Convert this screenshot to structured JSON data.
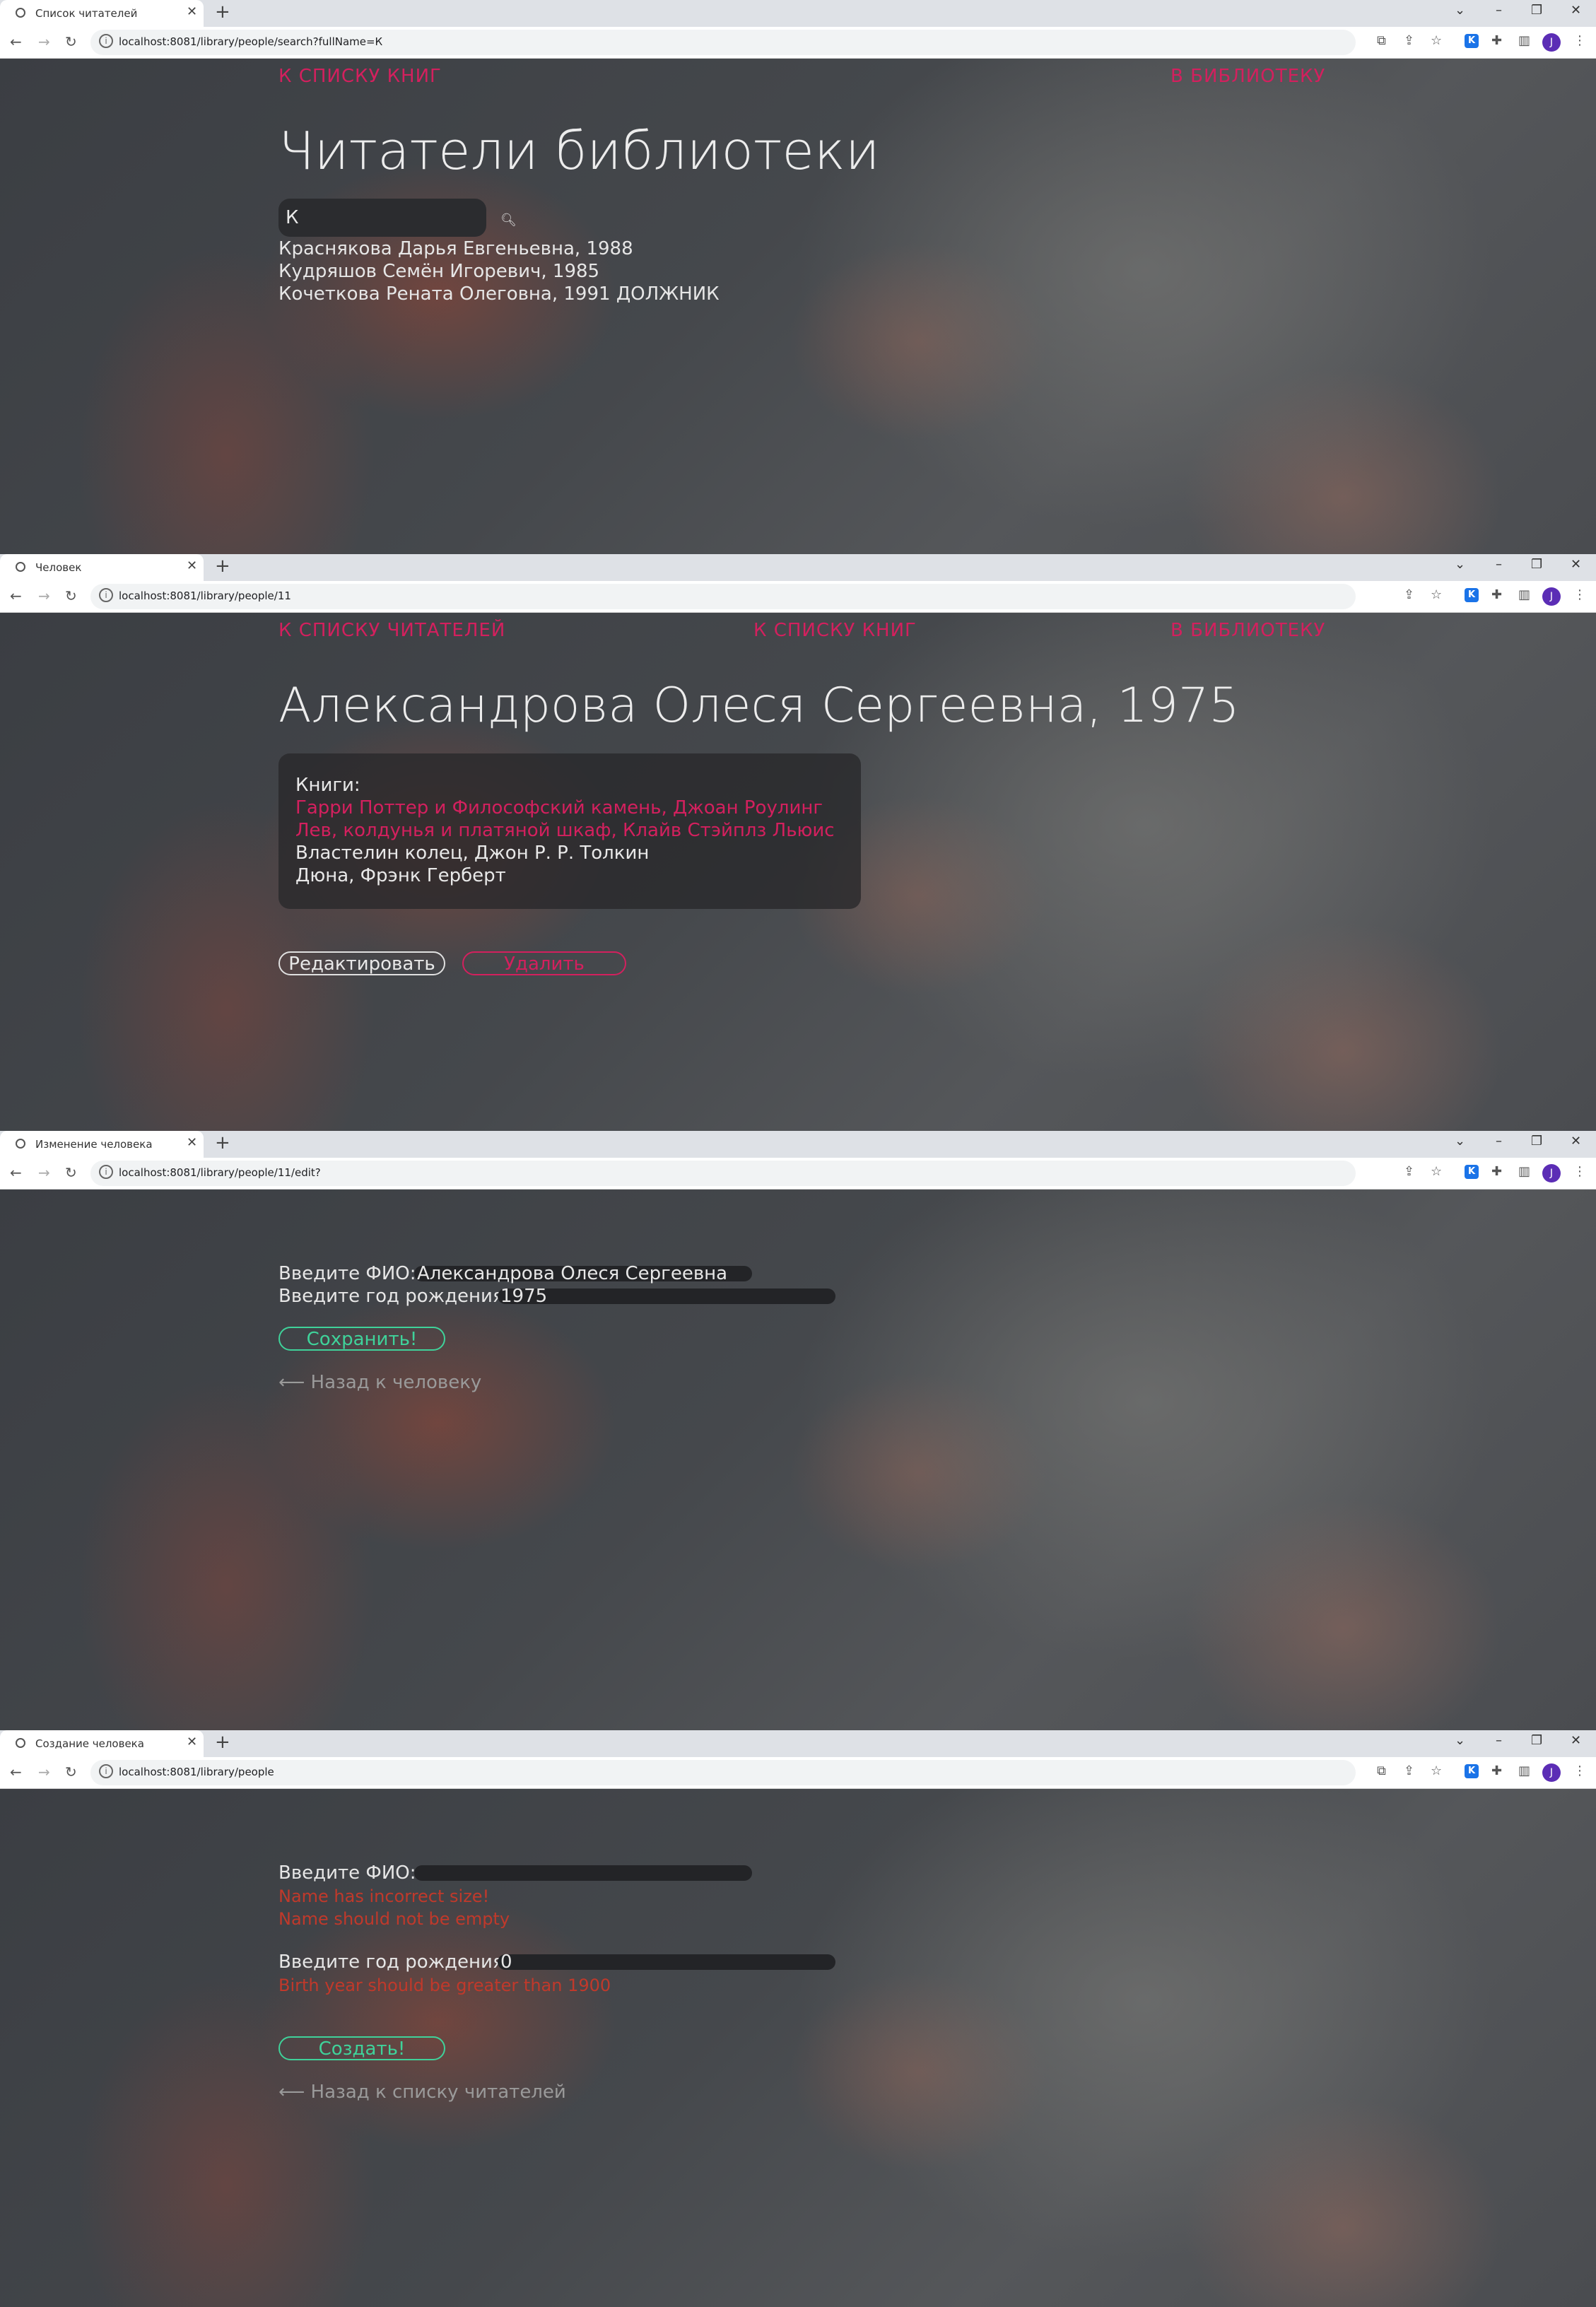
{
  "screens": [
    {
      "tab_title": "Список читателей",
      "url": "localhost:8081/library/people/search?fullName=К",
      "nav_left": "К СПИСКУ КНИГ",
      "nav_right": "В БИБЛИОТЕКУ",
      "title": "Читатели библиотеки",
      "search_value": "К",
      "results": [
        "Краснякова Дарья Евгеньевна, 1988",
        "Кудряшов Семён Игоревич, 1985",
        "Кочеткова Рената Олеговна, 1991 ДОЛЖНИК"
      ]
    },
    {
      "tab_title": "Человек",
      "url": "localhost:8081/library/people/11",
      "nav_left": "К СПИСКУ ЧИТАТЕЛЕЙ",
      "nav_center": "К СПИСКУ КНИГ",
      "nav_right": "В БИБЛИОТЕКУ",
      "title": "Александрова Олеся Сергеевна, 1975",
      "books_label": "Книги:",
      "books": [
        {
          "text": "Гарри Поттер и Философский камень, Джоан Роулинг",
          "overdue": true
        },
        {
          "text": "Лев, колдунья и платяной шкаф, Клайв Стэйплз Льюис",
          "overdue": true
        },
        {
          "text": "Властелин колец, Джон Р. Р. Толкин",
          "overdue": false
        },
        {
          "text": "Дюна, Фрэнк Герберт",
          "overdue": false
        }
      ],
      "edit_button": "Редактировать",
      "delete_button": "Удалить"
    },
    {
      "tab_title": "Изменение человека",
      "url": "localhost:8081/library/people/11/edit?",
      "fio_label": "Введите ФИО:",
      "fio_value": "Александрова Олеся Сергеевна",
      "year_label": "Введите год рождения:",
      "year_value": "1975",
      "save_button": "Сохранить!",
      "back_link": "⟵ Назад к человеку"
    },
    {
      "tab_title": "Создание человека",
      "url": "localhost:8081/library/people",
      "fio_label": "Введите ФИО:",
      "fio_value": "",
      "fio_errors": [
        "Name has incorrect size!",
        "Name should not be empty"
      ],
      "year_label": "Введите год рождения:",
      "year_value": "0",
      "year_error": "Birth year should be greater than 1900",
      "create_button": "Создать!",
      "back_link": "⟵ Назад к списку читателей"
    }
  ],
  "colors": {
    "accent_pink": "#d3205e",
    "accent_green": "#3fd29a",
    "error_red": "#c0392b",
    "avatar": "#5b2db5"
  },
  "avatar_letter": "J",
  "icons": [
    "globe-icon",
    "close-icon",
    "plus-icon",
    "back-arrow-icon",
    "forward-arrow-icon",
    "reload-icon",
    "info-icon",
    "translate-icon",
    "share-icon",
    "star-icon",
    "k-extension-icon",
    "puzzle-icon",
    "sidebar-icon",
    "kebab-menu-icon",
    "chevron-down-icon",
    "minimize-icon",
    "restore-icon",
    "search-icon"
  ]
}
